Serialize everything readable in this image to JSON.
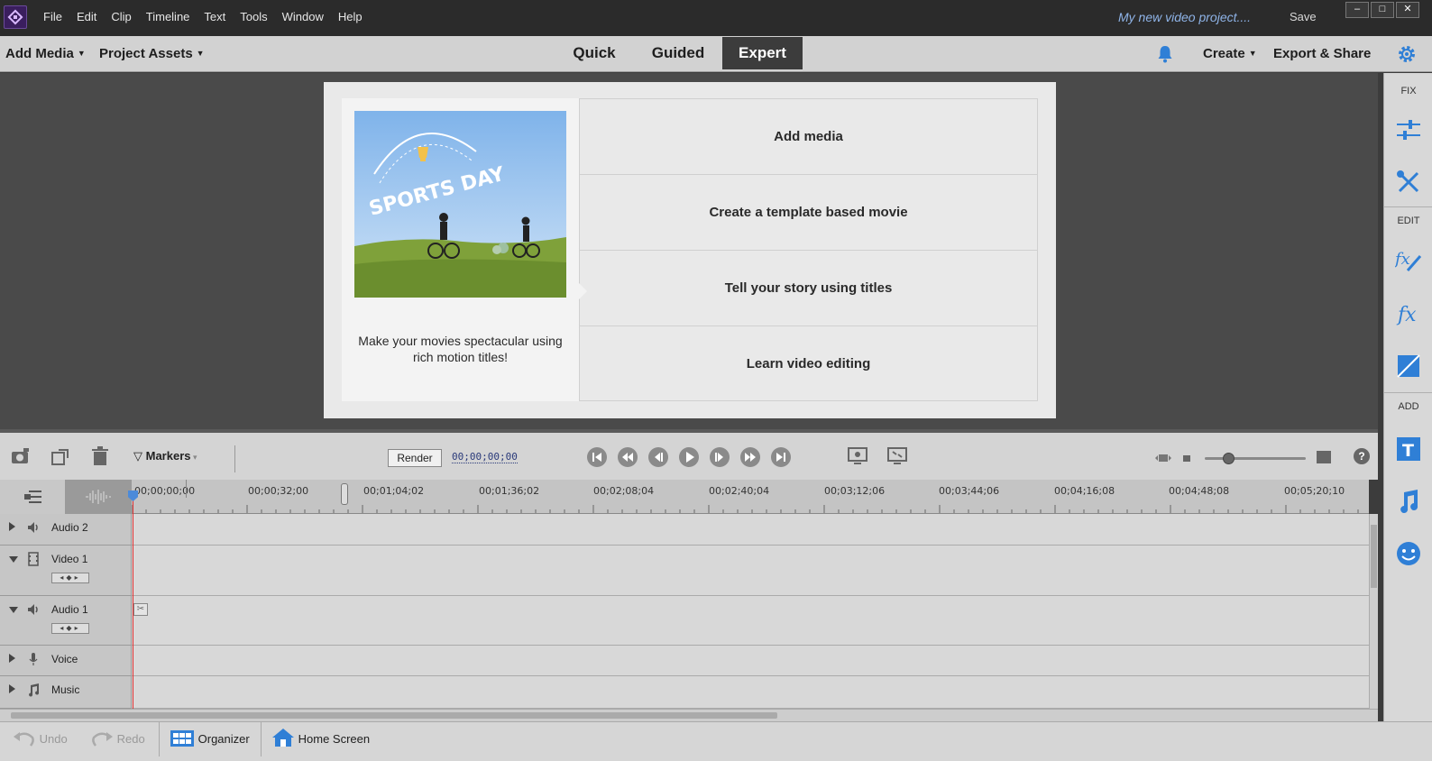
{
  "menubar": {
    "items": [
      "File",
      "Edit",
      "Clip",
      "Timeline",
      "Text",
      "Tools",
      "Window",
      "Help"
    ],
    "project_name": "My new video project....",
    "save_label": "Save"
  },
  "toolbar": {
    "add_media": "Add Media",
    "project_assets": "Project Assets",
    "modes": [
      "Quick",
      "Guided",
      "Expert"
    ],
    "active_mode": "Expert",
    "create": "Create",
    "export_share": "Export & Share"
  },
  "welcome": {
    "thumbnail_title": "SPORTS DAY",
    "caption": "Make your movies spectacular using rich motion titles!",
    "items": [
      "Add media",
      "Create a template based movie",
      "Tell your story using titles",
      "Learn video editing"
    ]
  },
  "right_panel": {
    "sections": [
      "FIX",
      "EDIT",
      "ADD"
    ]
  },
  "timeline_controls": {
    "markers_label": "Markers",
    "render_label": "Render",
    "timecode": "00;00;00;00",
    "zoom_level": 0.2
  },
  "ruler": {
    "labels": [
      "00;00;00;00",
      "00;00;32;00",
      "00;01;04;02",
      "00;01;36;02",
      "00;02;08;04",
      "00;02;40;04",
      "00;03;12;06",
      "00;03;44;06",
      "00;04;16;08",
      "00;04;48;08",
      "00;05;20;10"
    ]
  },
  "tracks": [
    {
      "name": "Audio 2",
      "icon": "speaker-icon",
      "expanded": false
    },
    {
      "name": "Video 1",
      "icon": "film-icon",
      "expanded": true
    },
    {
      "name": "Audio 1",
      "icon": "speaker-icon",
      "expanded": true
    },
    {
      "name": "Voice",
      "icon": "microphone-icon",
      "expanded": false
    },
    {
      "name": "Music",
      "icon": "music-note-icon",
      "expanded": false
    }
  ],
  "bottombar": {
    "undo": "Undo",
    "redo": "Redo",
    "organizer": "Organizer",
    "home_screen": "Home Screen"
  },
  "colors": {
    "accent_blue": "#4b8ad9",
    "active_tab": "#3c3c3c",
    "playhead": "#e03030"
  }
}
